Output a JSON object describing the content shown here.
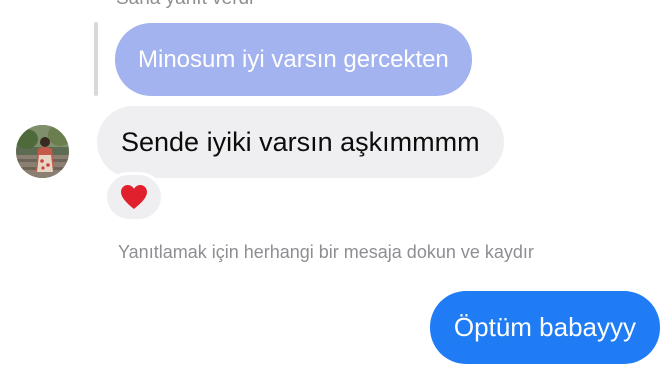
{
  "chat": {
    "reply_label": "Sana yanıt verdi",
    "quoted_message": "Minosum iyi varsın gercekten",
    "received_message": "Sende iyiki varsın aşkımmmm",
    "reaction": "heart-icon",
    "hint": "Yanıtlamak için herhangi bir mesaja dokun ve kaydır",
    "sent_message": "Öptüm babayyy"
  },
  "colors": {
    "quoted_bubble": "#a3b3f0",
    "received_bubble": "#efeff1",
    "sent_bubble": "#1f7cf5",
    "heart": "#e0202d",
    "muted_text": "#8e8e93"
  }
}
